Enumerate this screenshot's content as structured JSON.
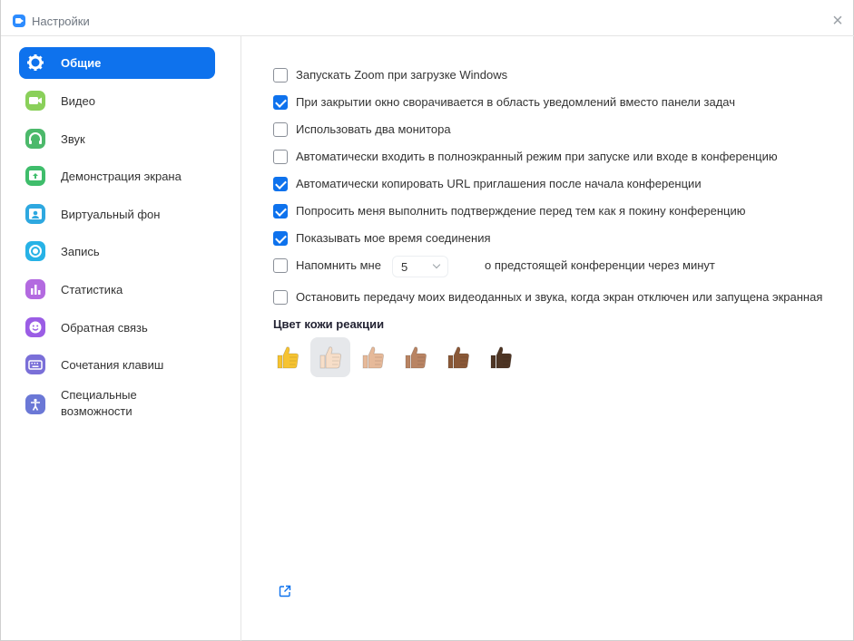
{
  "window": {
    "title": "Настройки",
    "close_glyph": "×"
  },
  "sidebar": {
    "items": [
      {
        "label": "Общие",
        "icon": "gear-icon",
        "color": "#0e72ed",
        "active": true
      },
      {
        "label": "Видео",
        "icon": "video-icon",
        "color": "#8ad05a"
      },
      {
        "label": "Звук",
        "icon": "headphones-icon",
        "color": "#4cb96b"
      },
      {
        "label": "Демонстрация экрана",
        "icon": "share-screen-icon",
        "color": "#3fbd6b"
      },
      {
        "label": "Виртуальный фон",
        "icon": "virtual-background-icon",
        "color": "#2ea8e0"
      },
      {
        "label": "Запись",
        "icon": "record-icon",
        "color": "#27b2e6"
      },
      {
        "label": "Статистика",
        "icon": "statistics-icon",
        "color": "#b36ae0"
      },
      {
        "label": "Обратная связь",
        "icon": "feedback-icon",
        "color": "#9b5de5"
      },
      {
        "label": "Сочетания клавиш",
        "icon": "keyboard-icon",
        "color": "#7a6fd8"
      },
      {
        "label": "Специальные возможности",
        "icon": "accessibility-icon",
        "color": "#6b78d6"
      }
    ]
  },
  "general": {
    "options": [
      {
        "label": "Запускать Zoom при загрузке Windows",
        "checked": false
      },
      {
        "label": "При закрытии окно сворачивается в область уведомлений вместо панели задач",
        "checked": true
      },
      {
        "label": "Использовать два монитора",
        "checked": false
      },
      {
        "label": "Автоматически входить в полноэкранный режим при запуске или входе в конференцию",
        "checked": false
      },
      {
        "label": "Автоматически копировать URL приглашения после начала конференции",
        "checked": true
      },
      {
        "label": "Попросить меня выполнить подтверждение перед тем как я покину конференцию",
        "checked": true
      },
      {
        "label": "Показывать мое время соединения",
        "checked": true
      }
    ],
    "reminder": {
      "label_before": "Напомнить мне",
      "value": "5",
      "label_after": "о предстоящей конференции через минут",
      "checked": false
    },
    "stop_video": {
      "label": "Остановить передачу моих видеоданных и звука, когда экран отключен или запущена экранная",
      "checked": false
    },
    "skin_tone": {
      "title": "Цвет кожи реакции",
      "selected_index": 1,
      "tones": [
        "#f6c332",
        "#f7dec8",
        "#e6b999",
        "#b98463",
        "#8a5837",
        "#4e3524"
      ]
    },
    "external_link_icon": "external-link-icon"
  }
}
